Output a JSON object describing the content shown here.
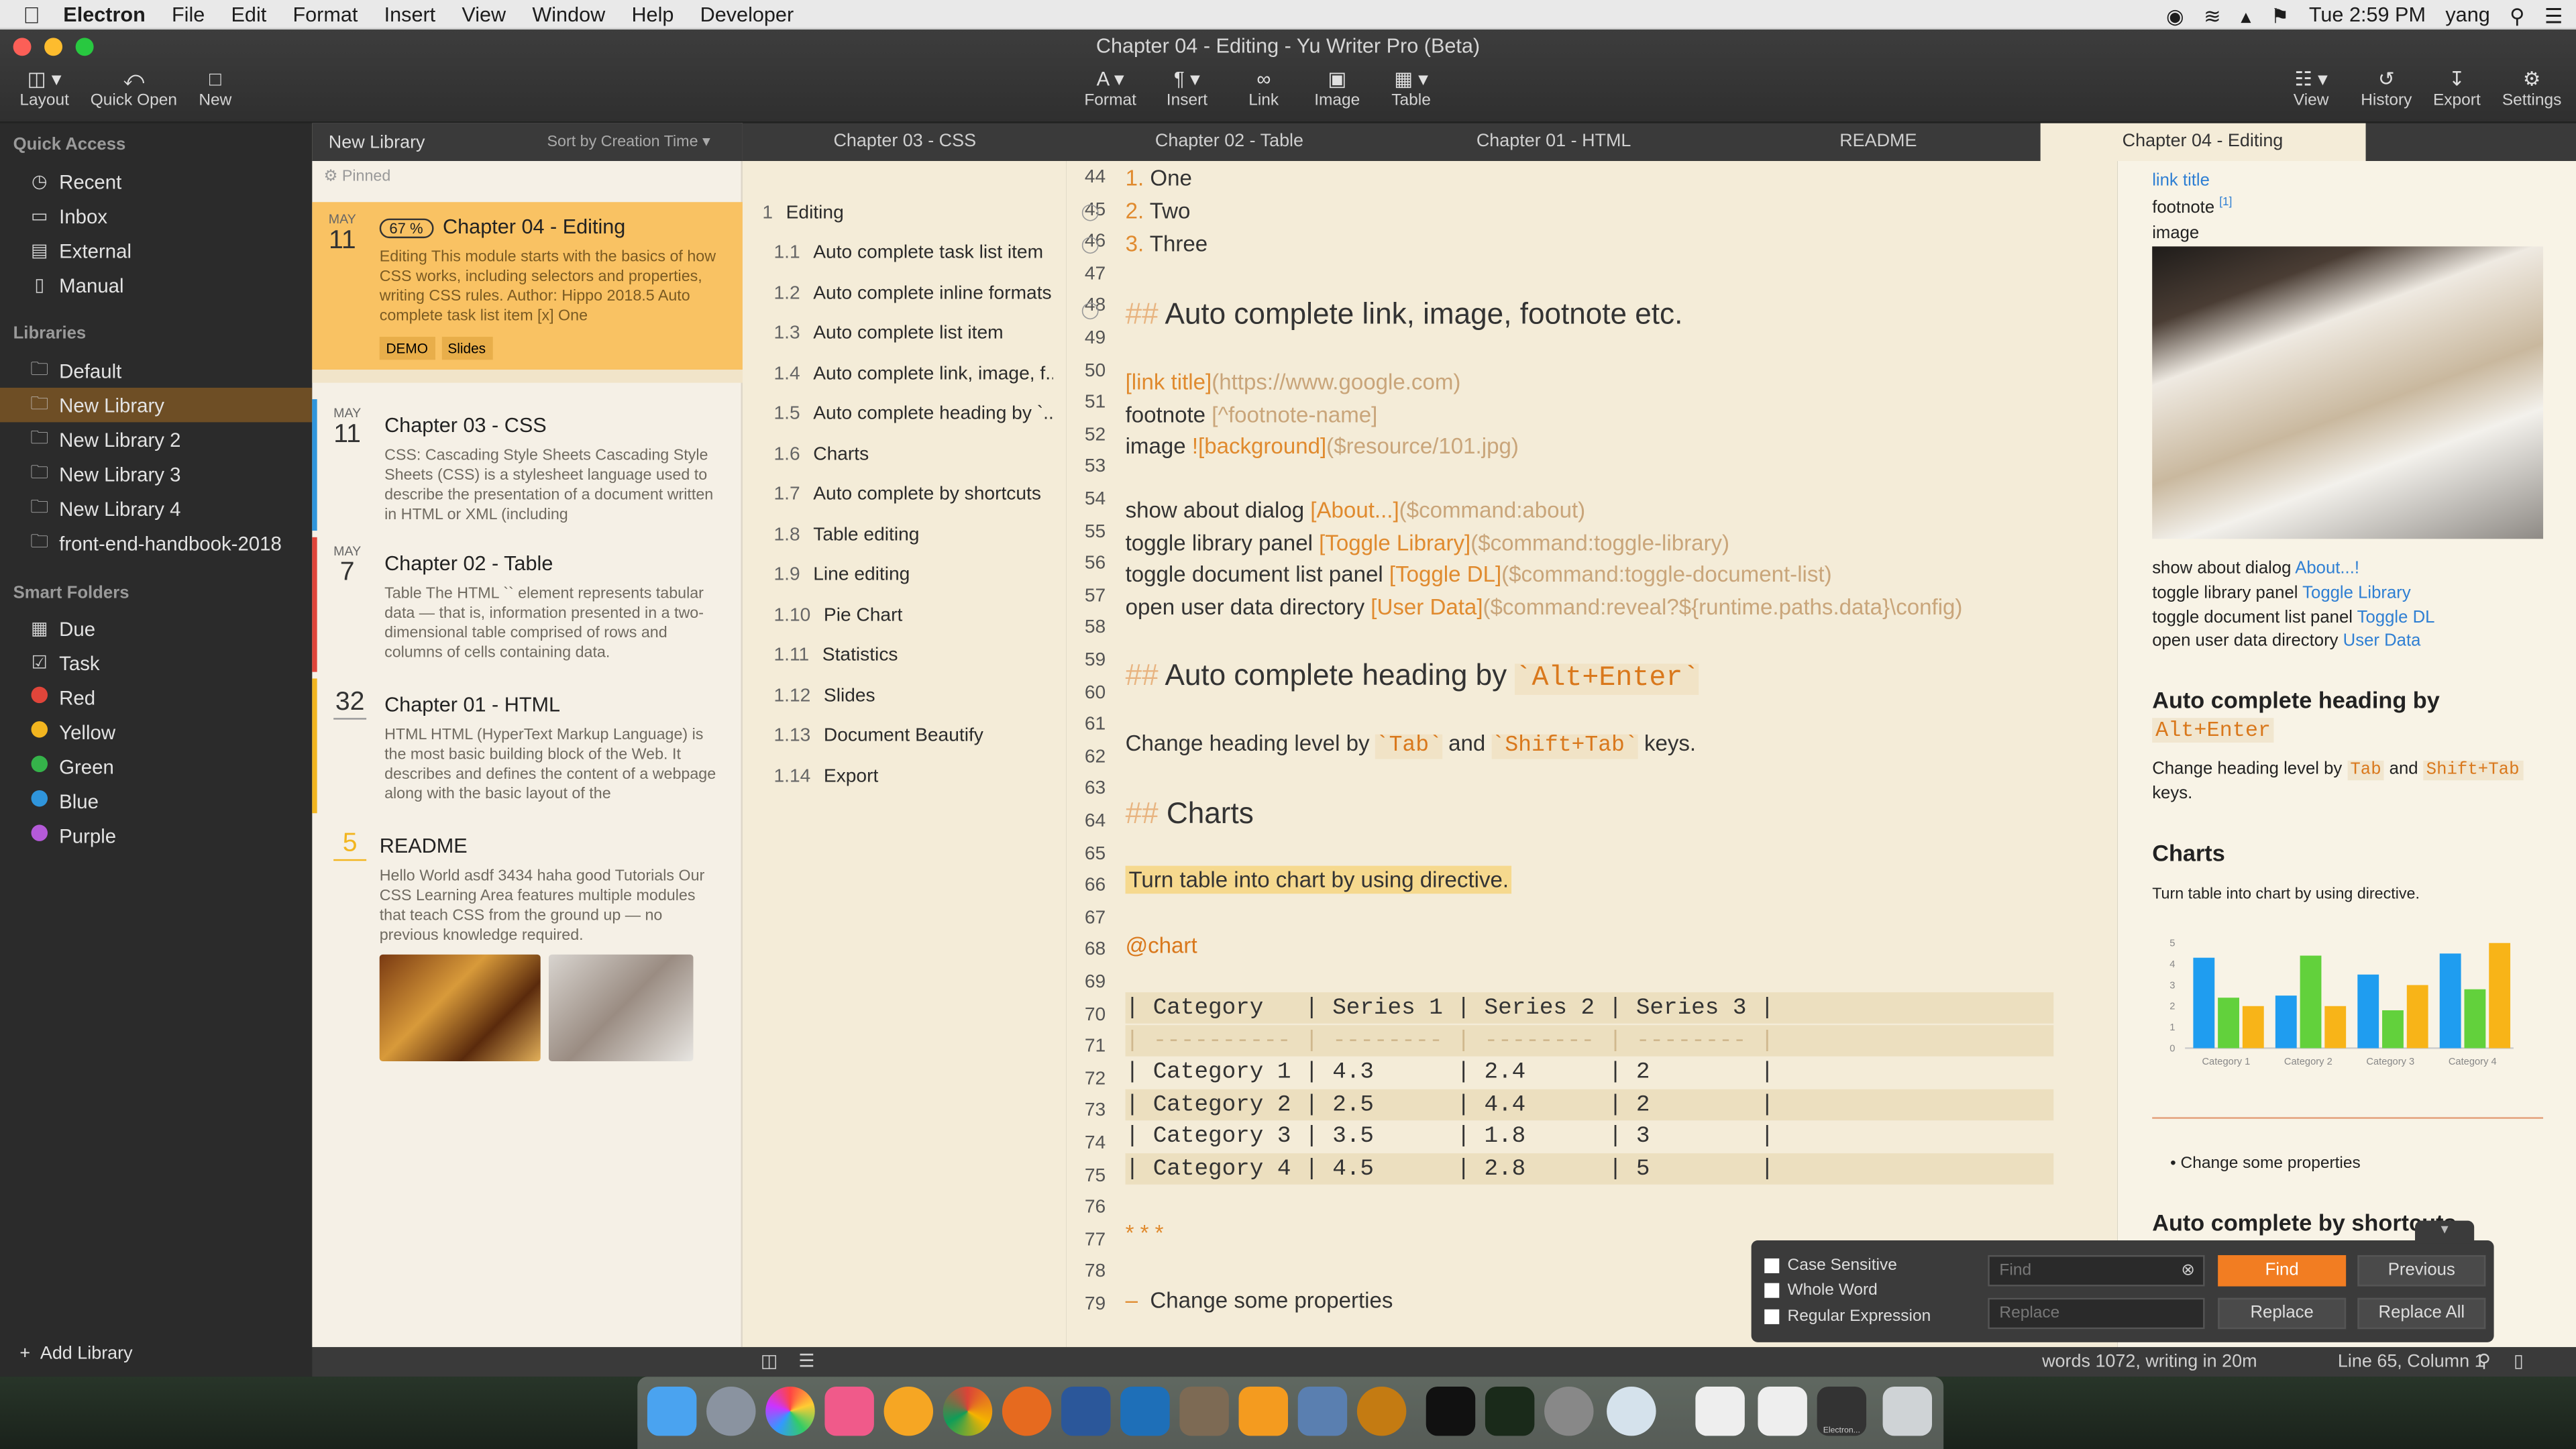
{
  "menubar": {
    "app": "Electron",
    "items": [
      "File",
      "Edit",
      "Format",
      "Insert",
      "View",
      "Window",
      "Help",
      "Developer"
    ],
    "clock": "Tue 2:59 PM",
    "user": "yang"
  },
  "window": {
    "title": "Chapter 04 - Editing - Yu Writer Pro (Beta)"
  },
  "toolbar": {
    "layout": "Layout",
    "quick_open": "Quick Open",
    "new": "New",
    "format": "Format",
    "insert": "Insert",
    "link": "Link",
    "image": "Image",
    "table": "Table",
    "view": "View",
    "history": "History",
    "export": "Export",
    "settings": "Settings"
  },
  "sidebar": {
    "quick_access": "Quick Access",
    "qa_items": [
      {
        "label": "Recent",
        "icon": "clock-icon"
      },
      {
        "label": "Inbox",
        "icon": "inbox-icon"
      },
      {
        "label": "External",
        "icon": "document-icon"
      },
      {
        "label": "Manual",
        "icon": "book-icon"
      }
    ],
    "libraries": "Libraries",
    "lib_items": [
      "Default",
      "New Library",
      "New Library 2",
      "New Library 3",
      "New Library 4",
      "front-end-handbook-2018"
    ],
    "smart_folders": "Smart Folders",
    "smart_items": [
      {
        "label": "Due",
        "color": "",
        "icon": "calendar-icon"
      },
      {
        "label": "Task",
        "color": "",
        "icon": "checkbox-icon"
      },
      {
        "label": "Red",
        "color": "#e0453a"
      },
      {
        "label": "Yellow",
        "color": "#f2b51f"
      },
      {
        "label": "Green",
        "color": "#35b34a"
      },
      {
        "label": "Blue",
        "color": "#2f95dc"
      },
      {
        "label": "Purple",
        "color": "#b45ad8"
      }
    ],
    "add_library": "Add Library"
  },
  "doclist": {
    "title": "New Library",
    "sort": "Sort by Creation Time",
    "pinned": "Pinned",
    "cards": [
      {
        "month": "MAY",
        "day": "11",
        "badge": "67 %",
        "title": "Chapter 04 - Editing",
        "summary": "Editing This module starts with the basics of how CSS works, including selectors and properties, writing CSS rules. Author: Hippo 2018.5 Auto complete task list item [x] One",
        "tags": [
          "DEMO",
          "Slides"
        ],
        "color": "#f7b731"
      },
      {
        "month": "MAY",
        "day": "11",
        "title": "Chapter 03 - CSS",
        "summary": "CSS: Cascading Style Sheets Cascading Style Sheets (CSS) is a stylesheet language used to describe the presentation of a document written in HTML or XML (including",
        "color": "#2f95dc"
      },
      {
        "month": "MAY",
        "day": "7",
        "title": "Chapter 02 - Table",
        "summary": "Table The HTML `` element represents tabular data — that is, information presented in a two-dimensional table comprised of rows and columns of cells containing data.",
        "color": "#e0453a"
      },
      {
        "month": "",
        "day": "32",
        "title": "Chapter 01 - HTML",
        "summary": "HTML HTML (HyperText Markup Language) is the most basic building block of the Web. It describes and defines the content of a webpage along with the basic layout of the",
        "color": "#f2b51f"
      },
      {
        "month": "",
        "day": "5",
        "title": "README",
        "summary": "Hello World asdf 3434 haha good Tutorials Our CSS Learning Area features multiple modules that teach CSS from the ground up — no previous knowledge required.",
        "color": ""
      }
    ]
  },
  "tabs": [
    "Chapter 03 - CSS",
    "Chapter 02 - Table",
    "Chapter 01 - HTML",
    "README",
    "Chapter 04 - Editing"
  ],
  "outline": [
    {
      "n": "1",
      "t": "Editing"
    },
    {
      "n": "1.1",
      "t": "Auto complete task list item"
    },
    {
      "n": "1.2",
      "t": "Auto complete inline formats"
    },
    {
      "n": "1.3",
      "t": "Auto complete list item"
    },
    {
      "n": "1.4",
      "t": "Auto complete link, image, f..."
    },
    {
      "n": "1.5",
      "t": "Auto complete heading by `..."
    },
    {
      "n": "1.6",
      "t": "Charts"
    },
    {
      "n": "1.7",
      "t": "Auto complete by shortcuts"
    },
    {
      "n": "1.8",
      "t": "Table editing"
    },
    {
      "n": "1.9",
      "t": "Line editing"
    },
    {
      "n": "1.10",
      "t": "Pie Chart"
    },
    {
      "n": "1.11",
      "t": "Statistics"
    },
    {
      "n": "1.12",
      "t": "Slides"
    },
    {
      "n": "1.13",
      "t": "Document Beautify"
    },
    {
      "n": "1.14",
      "t": "Export"
    }
  ],
  "editor": {
    "lines": [
      "44",
      "45",
      "46",
      "47",
      "48",
      "49",
      "50",
      "51",
      "52",
      "53",
      "54",
      "55",
      "56",
      "57",
      "58",
      "59",
      "60",
      "61",
      "62",
      "63",
      "64",
      "65",
      "66",
      "67",
      "68",
      "69",
      "70",
      "71",
      "72",
      "73",
      "74",
      "75",
      "76",
      "77",
      "78",
      "79"
    ],
    "l44": "1.",
    "l44t": "One",
    "l45": "2.",
    "l45t": "Two",
    "l46": "3.",
    "l46t": "Three",
    "h48": "Auto complete link, image, footnote etc.",
    "l50a": "[link title]",
    "l50b": "(https://www.google.com)",
    "l51a": "footnote ",
    "l51b": "[^footnote-name]",
    "l52a": "image ",
    "l52b": "![background]",
    "l52c": "($resource/101.jpg)",
    "l54a": "show about dialog ",
    "l54b": "[About...]",
    "l54c": "($command:about)",
    "l55a": "toggle library panel ",
    "l55b": "[Toggle Library]",
    "l55c": "($command:toggle-library)",
    "l56a": "toggle document list panel ",
    "l56b": "[Toggle DL]",
    "l56c": "($command:toggle-document-list)",
    "l57a": "open user data directory ",
    "l57b": "[User Data]",
    "l57c": "($command:reveal?${runtime.paths.data}\\config)",
    "h59a": "Auto complete heading by ",
    "h59b": "`Alt+Enter`",
    "l61a": "Change heading level by ",
    "l61b": "`Tab`",
    "l61c": " and ",
    "l61d": "`Shift+Tab`",
    "l61e": " keys.",
    "h63": "Charts",
    "l65": "Turn table into chart by using directive.",
    "l67": "@chart",
    "t69": "| Category   | Series 1 | Series 2 | Series 3 |",
    "t70": "| ---------- | -------- | -------- | -------- |",
    "t71": "| Category 1 | 4.3      | 2.4      | 2        |",
    "t72": "| Category 2 | 2.5      | 4.4      | 2        |",
    "t73": "| Category 3 | 3.5      | 1.8      | 3        |",
    "t74": "| Category 4 | 4.5      | 2.8      | 5        |",
    "l76": "* * *",
    "l78a": "–",
    "l78b": "Change some properties"
  },
  "preview": {
    "link_title": "link title",
    "footnote": "footnote",
    "footnote_sup": "[1]",
    "image": "image",
    "about_a": "show about dialog ",
    "about_b": "About...!",
    "lib_a": "toggle library panel ",
    "lib_b": "Toggle Library",
    "dl_a": "toggle document list panel ",
    "dl_b": "Toggle DL",
    "ud_a": "open user data directory ",
    "ud_b": "User Data",
    "h_heading": "Auto complete heading by",
    "h_heading_code": "Alt+Enter",
    "ch_a": "Change heading level by ",
    "ch_b": "Tab",
    "ch_c": " and ",
    "ch_d": "Shift+Tab",
    "ch_e": "keys.",
    "h_charts": "Charts",
    "charts_text": "Turn table into chart by using directive.",
    "bullet": "Change some properties",
    "h_shortcuts": "Auto complete by shortcuts"
  },
  "chart_data": {
    "type": "bar",
    "categories": [
      "Category 1",
      "Category 2",
      "Category 3",
      "Category 4"
    ],
    "series": [
      {
        "name": "Series 1",
        "values": [
          4.3,
          2.5,
          3.5,
          4.5
        ]
      },
      {
        "name": "Series 2",
        "values": [
          2.4,
          4.4,
          1.8,
          2.8
        ]
      },
      {
        "name": "Series 3",
        "values": [
          2,
          2,
          3,
          5
        ]
      }
    ],
    "colors": [
      "#1f9df0",
      "#62d13c",
      "#f8b418"
    ],
    "ylim": [
      0,
      5
    ],
    "yticks": [
      "0",
      "1",
      "2",
      "3",
      "4",
      "5"
    ]
  },
  "findbar": {
    "case": "Case Sensitive",
    "word": "Whole Word",
    "regex": "Regular Expression",
    "find_ph": "Find",
    "replace_ph": "Replace",
    "find": "Find",
    "previous": "Previous",
    "replace": "Replace",
    "replace_all": "Replace All"
  },
  "status": {
    "words": "words 1072, writing in 20m",
    "pos": "Line 65, Column 1"
  },
  "dock": {
    "label": "Electron..."
  }
}
